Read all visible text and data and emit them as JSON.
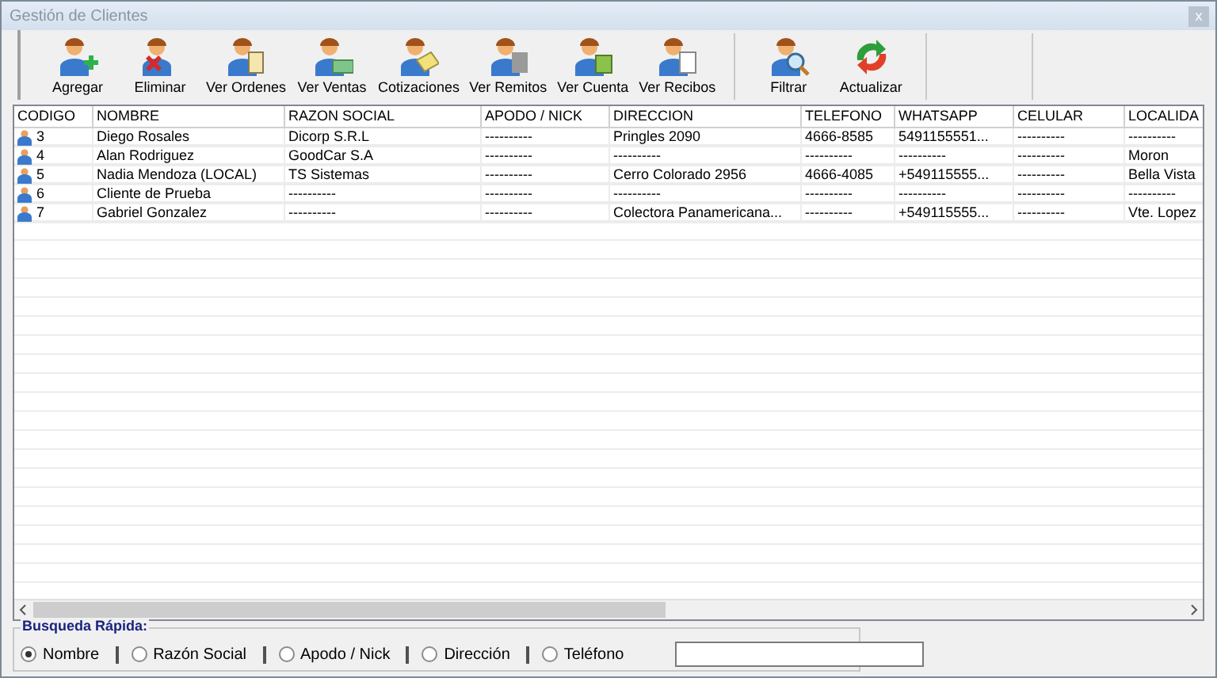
{
  "window": {
    "title": "Gestión de Clientes",
    "close": "x"
  },
  "toolbar": [
    {
      "label": "Agregar",
      "kind": "add"
    },
    {
      "label": "Eliminar",
      "kind": "delete"
    },
    {
      "label": "Ver Ordenes",
      "kind": "clipboard"
    },
    {
      "label": "Ver Ventas",
      "kind": "money"
    },
    {
      "label": "Cotizaciones",
      "kind": "quote"
    },
    {
      "label": "Ver Remitos",
      "kind": "sheet"
    },
    {
      "label": "Ver Cuenta",
      "kind": "cash"
    },
    {
      "label": "Ver Recibos",
      "kind": "receipt"
    },
    {
      "label": "Filtrar",
      "kind": "filter",
      "group_start": true
    },
    {
      "label": "Actualizar",
      "kind": "refresh"
    }
  ],
  "table": {
    "columns": [
      "CODIGO",
      "NOMBRE",
      "RAZON SOCIAL",
      "APODO / NICK",
      "DIRECCION",
      "TELEFONO",
      "WHATSAPP",
      "CELULAR",
      "LOCALIDA"
    ],
    "rows": [
      [
        "3",
        "Diego Rosales",
        "Dicorp S.R.L",
        "----------",
        "Pringles 2090",
        "4666-8585",
        "5491155551...",
        "----------",
        "----------"
      ],
      [
        "4",
        "Alan Rodriguez",
        "GoodCar S.A",
        "----------",
        "----------",
        "----------",
        "----------",
        "----------",
        "Moron"
      ],
      [
        "5",
        "Nadia Mendoza (LOCAL)",
        "TS Sistemas",
        "----------",
        "Cerro Colorado 2956",
        "4666-4085",
        "+549115555...",
        "----------",
        "Bella Vista"
      ],
      [
        "6",
        "Cliente de Prueba",
        "----------",
        "----------",
        "----------",
        "----------",
        "----------",
        "----------",
        "----------"
      ],
      [
        "7",
        "Gabriel Gonzalez",
        "----------",
        "----------",
        "Colectora Panamericana...",
        "----------",
        "+549115555...",
        "----------",
        "Vte. Lopez"
      ]
    ]
  },
  "quick_search": {
    "title": "Busqueda Rápida:",
    "options": [
      {
        "label": "Nombre",
        "selected": true
      },
      {
        "label": "Razón Social",
        "selected": false
      },
      {
        "label": "Apodo / Nick",
        "selected": false
      },
      {
        "label": "Dirección",
        "selected": false
      },
      {
        "label": "Teléfono",
        "selected": false
      }
    ]
  }
}
